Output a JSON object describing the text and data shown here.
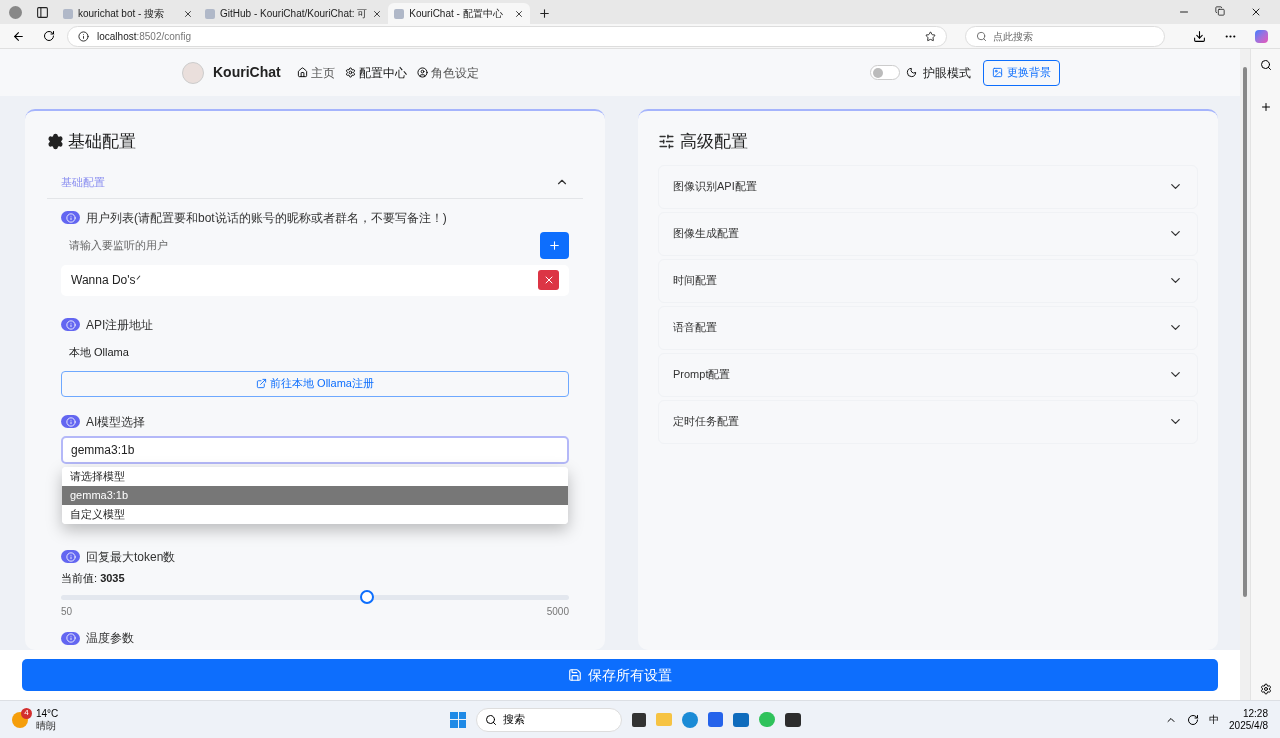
{
  "browser": {
    "tabs": [
      {
        "title": "kourichat bot - 搜索",
        "selected": false
      },
      {
        "title": "GitHub - KouriChat/KouriChat: 可",
        "selected": false
      },
      {
        "title": "KouriChat - 配置中心",
        "selected": true
      }
    ],
    "address_host": "localhost",
    "address_path": ":8502/config",
    "search_placeholder": "点此搜索"
  },
  "nav": {
    "brand": "KouriChat",
    "links": [
      {
        "label": "主页",
        "selected": false
      },
      {
        "label": "配置中心",
        "selected": true
      },
      {
        "label": "角色设定",
        "selected": false
      }
    ],
    "eye_mode": {
      "label": "护眼模式",
      "on": false
    },
    "background_button": "更换背景"
  },
  "basic": {
    "title": "基础配置",
    "section": {
      "title": "基础配置",
      "expanded": true
    },
    "users": {
      "label": "用户列表(请配置要和bot说话的账号的昵称或者群名，不要写备注！)",
      "placeholder": "请输入要监听的用户",
      "items": [
        "Wanna Do'sᐟ"
      ]
    },
    "api": {
      "label": "API注册地址",
      "value": "本地 Ollama",
      "link": "前往本地 Ollama注册"
    },
    "model": {
      "label": "AI模型选择",
      "value": "gemma3:1b",
      "options": [
        {
          "label": "请选择模型",
          "selected": false
        },
        {
          "label": "gemma3:1b",
          "selected": true
        },
        {
          "label": "自定义模型",
          "selected": false
        }
      ]
    },
    "tokens": {
      "label": "回复最大token数",
      "current_label": "当前值:",
      "current": "3035",
      "level": 0.603,
      "min": "50",
      "max": "5000"
    },
    "temperature": {
      "label": "温度参数"
    }
  },
  "advanced": {
    "title": "高级配置",
    "sections": [
      {
        "title": "图像识别API配置",
        "expanded": false
      },
      {
        "title": "图像生成配置",
        "expanded": false
      },
      {
        "title": "时间配置",
        "expanded": false
      },
      {
        "title": "语音配置",
        "expanded": false
      },
      {
        "title": "Prompt配置",
        "expanded": false
      },
      {
        "title": "定时任务配置",
        "expanded": false
      }
    ]
  },
  "save_button": "保存所有设置",
  "taskbar": {
    "weather_badge": "4",
    "temperature": "14°C",
    "condition": "晴朗",
    "search": "搜索",
    "input_method": "中",
    "time": "12:28",
    "date": "2025/4/8"
  }
}
